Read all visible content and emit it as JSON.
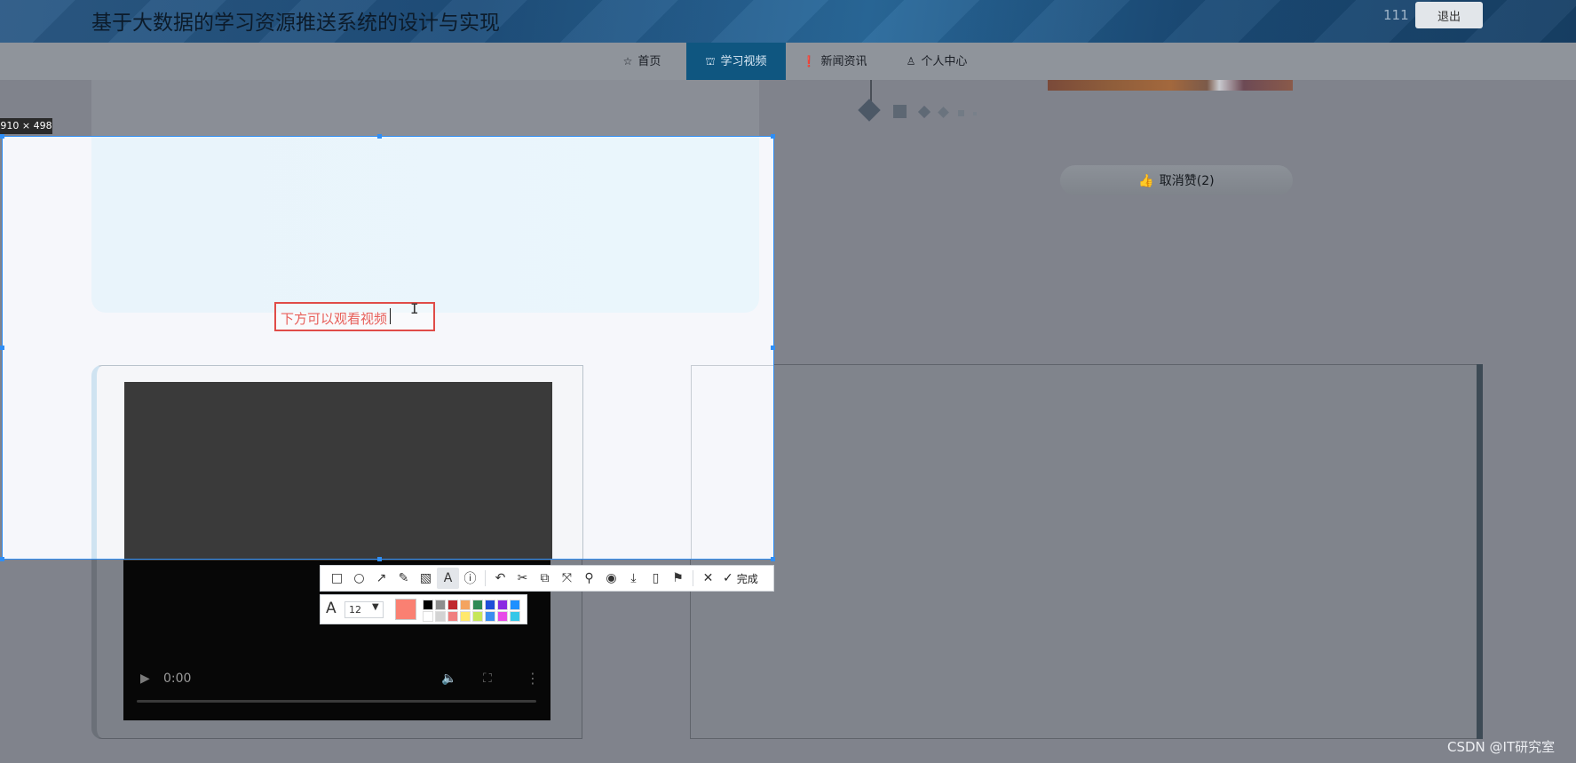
{
  "header": {
    "title": "基于大数据的学习资源推送系统的设计与实现",
    "username": "111",
    "logout_label": "退出"
  },
  "nav": {
    "items": [
      {
        "label": "首页",
        "icon": "star-icon",
        "glyph": "☆"
      },
      {
        "label": "学习视频",
        "icon": "bag-icon",
        "glyph": "⛫",
        "active": true
      },
      {
        "label": "新闻资讯",
        "icon": "info-icon",
        "glyph": "❗"
      },
      {
        "label": "个人中心",
        "icon": "user-icon",
        "glyph": "♙"
      }
    ]
  },
  "detail": {
    "unlike_label": "取消赞(2)",
    "unlike_icon": "thumb-up-icon"
  },
  "video": {
    "time": "0:00"
  },
  "capture": {
    "dimensions": "910 × 498",
    "annotation_text": "下方可以观看视频",
    "toolbar": {
      "tools": [
        {
          "name": "rectangle-tool-button",
          "glyph": "□"
        },
        {
          "name": "ellipse-tool-button",
          "glyph": "○"
        },
        {
          "name": "arrow-tool-button",
          "glyph": "↗"
        },
        {
          "name": "pen-tool-button",
          "glyph": "✎"
        },
        {
          "name": "mosaic-tool-button",
          "glyph": "▧"
        },
        {
          "name": "text-tool-button",
          "glyph": "A",
          "active": true
        },
        {
          "name": "number-tool-button",
          "glyph": "ⓘ"
        },
        {
          "name": "undo-button",
          "glyph": "↶"
        },
        {
          "name": "long-screenshot-button",
          "glyph": "✂"
        },
        {
          "name": "ocr-button",
          "glyph": "⧉"
        },
        {
          "name": "translate-button",
          "glyph": "⤧"
        },
        {
          "name": "pin-button",
          "glyph": "⚲"
        },
        {
          "name": "record-button",
          "glyph": "◉"
        },
        {
          "name": "download-button",
          "glyph": "⤓"
        },
        {
          "name": "phone-button",
          "glyph": "▯"
        },
        {
          "name": "bookmark-button",
          "glyph": "⚑"
        },
        {
          "name": "close-button",
          "glyph": "✕"
        }
      ],
      "done_label": "完成"
    },
    "text_style": {
      "font_size": "12",
      "current_color": "#fa8072",
      "palette_top": [
        "#000000",
        "#8e8e8e",
        "#c0282d",
        "#f4a460",
        "#2e8b57",
        "#1e4fd8",
        "#8a2be2",
        "#1e90ff"
      ],
      "palette_bottom": [
        "#ffffff",
        "#d3d3d3",
        "#f08080",
        "#ffe86b",
        "#c6e65a",
        "#3b8ef0",
        "#e84ae8",
        "#36c7e8"
      ]
    }
  },
  "watermark": "CSDN @IT研究室"
}
